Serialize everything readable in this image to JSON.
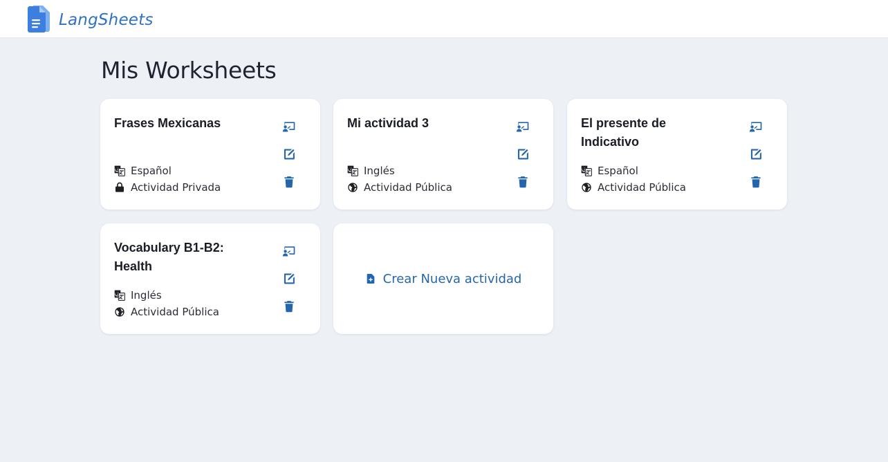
{
  "app": {
    "name": "LangSheets",
    "logo_icon": "document-icon",
    "accent": "#2e72c4"
  },
  "page": {
    "title": "Mis Worksheets"
  },
  "worksheets": [
    {
      "title": "Frases Mexicanas",
      "language": "Español",
      "visibility": "Actividad Privada",
      "visibility_icon": "lock-icon"
    },
    {
      "title": "Mi actividad 3",
      "language": "Inglés",
      "visibility": "Actividad Pública",
      "visibility_icon": "globe-icon"
    },
    {
      "title": "El presente de Indicativo",
      "language": "Español",
      "visibility": "Actividad Pública",
      "visibility_icon": "globe-icon"
    },
    {
      "title": "Vocabulary B1-B2: Health",
      "language": "Inglés",
      "visibility": "Actividad Pública",
      "visibility_icon": "globe-icon"
    }
  ],
  "card_actions": {
    "icons": [
      "present-icon",
      "edit-icon",
      "trash-icon"
    ],
    "color": "#2466ad"
  },
  "create": {
    "label": "Crear Nueva actividad",
    "icon": "add-file-icon"
  }
}
